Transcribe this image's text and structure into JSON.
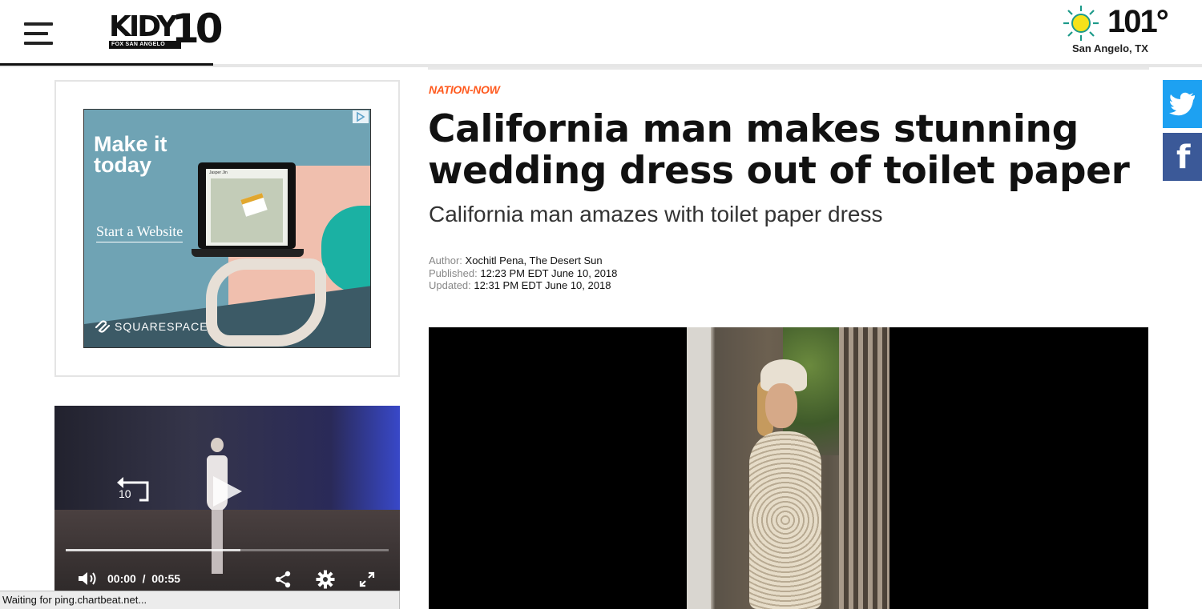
{
  "header": {
    "logo": {
      "wordmark": "KIDY",
      "number": "10",
      "tagline": "FOX SAN ANGELO"
    },
    "weather": {
      "temperature": "101°",
      "location": "San Angelo, TX",
      "icon": "sun-icon"
    }
  },
  "ad": {
    "headline": "Make it today",
    "cta": "Start a Website",
    "brand": "SQUARESPACE",
    "screen_caption": "Jasper Jin"
  },
  "side_video": {
    "replay_seconds": "10",
    "time_current": "00:00",
    "time_separator": "/",
    "time_total": "00:55",
    "progress_fraction": 0.54
  },
  "status_bar": {
    "text": "Waiting for ping.chartbeat.net..."
  },
  "article": {
    "section": "NATION-NOW",
    "headline": "California man makes stunning wedding dress out of toilet paper",
    "subhead": "California man amazes with toilet paper dress",
    "author_label": "Author:",
    "author": "Xochitl Pena, The Desert Sun",
    "published_label": "Published:",
    "published": "12:23 PM EDT June 10, 2018",
    "updated_label": "Updated:",
    "updated": "12:31 PM EDT June 10, 2018"
  },
  "social": {
    "twitter_icon": "twitter-icon",
    "facebook_icon": "facebook-icon",
    "facebook_glyph": "f"
  },
  "colors": {
    "section_accent": "#ff5a1f",
    "twitter": "#1da1f2",
    "facebook": "#3b5998",
    "ad_background": "#6fa3b4"
  }
}
